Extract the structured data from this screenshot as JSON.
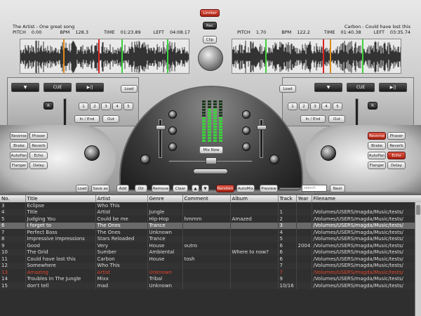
{
  "deck_left": {
    "track": "The Artist - One great song",
    "pitch_label": "PITCH",
    "pitch": "0.00",
    "bpm_label": "BPM",
    "bpm": "128.3",
    "time_label": "TIME",
    "time": "01:23.89",
    "left_label": "LEFT",
    "left": "04:08.17",
    "buttons": {
      "play_prev": "▼",
      "cue": "CUE",
      "play_pause": "▶||",
      "load": "Load",
      "r": "R",
      "in_end": "In / End",
      "out": "Out",
      "nums": [
        "1",
        "2",
        "3",
        "4",
        "5"
      ]
    },
    "effects": [
      {
        "label": "Reverse",
        "active": false
      },
      {
        "label": "Phaser",
        "active": false
      },
      {
        "label": "Brake",
        "active": false
      },
      {
        "label": "Reverb",
        "active": false
      },
      {
        "label": "AutoPan",
        "active": false
      },
      {
        "label": "Echo",
        "active": false
      },
      {
        "label": "Flanger",
        "active": false
      },
      {
        "label": "Delay",
        "active": false
      }
    ],
    "nudge": ">"
  },
  "deck_right": {
    "track": "Carbon - Could have lost this",
    "pitch_label": "PITCH",
    "pitch": "1.70",
    "bpm_label": "BPM",
    "bpm": "122.2",
    "time_label": "TIME",
    "time": "01:40.38",
    "left_label": "LEFT",
    "left": "03:35.74",
    "buttons": {
      "play_prev": "▼",
      "cue": "CUE",
      "play_pause": "▶||",
      "load": "Load",
      "r": "R",
      "in_end": "In / End",
      "out": "Out",
      "nums": [
        "1",
        "2",
        "3",
        "4",
        "5"
      ]
    },
    "effects": [
      {
        "label": "Reverse",
        "active": true
      },
      {
        "label": "Phaser",
        "active": false
      },
      {
        "label": "Brake",
        "active": false
      },
      {
        "label": "Reverb",
        "active": false
      },
      {
        "label": "AutoPan",
        "active": false
      },
      {
        "label": "Echo",
        "active": true
      },
      {
        "label": "Flanger",
        "active": false
      },
      {
        "label": "Delay",
        "active": false
      }
    ],
    "nudge": "<"
  },
  "center": {
    "limiter": "Limiter",
    "rec": "Rec",
    "clip": "Clip",
    "mix_now": "Mix Now"
  },
  "library_bar": {
    "buttons": [
      "Load",
      "Save as",
      "Add",
      "Dir",
      "Remove",
      "Clear"
    ],
    "random": "Random",
    "automix": "AutoMix",
    "preview": "Preview",
    "search_placeholder": "search songs",
    "next": "Next"
  },
  "table": {
    "columns": [
      "No.",
      "Title",
      "Artist",
      "Genre",
      "Comment",
      "Album",
      "Track",
      "Year",
      "Filename"
    ],
    "rows": [
      {
        "no": "3",
        "title": "Eclipse",
        "artist": "Who This",
        "genre": "",
        "comment": "",
        "album": "",
        "track": "",
        "year": "",
        "file": "",
        "style": ""
      },
      {
        "no": "4",
        "title": "Title",
        "artist": "Artist",
        "genre": "Jungle",
        "comment": "",
        "album": "",
        "track": "1",
        "year": "",
        "file": "/Volumes/USERS/magda/Music/tests/",
        "style": "alt"
      },
      {
        "no": "5",
        "title": "Judging You",
        "artist": "Could be me",
        "genre": "Hip-Hop",
        "comment": "hmmm",
        "album": "Amazed",
        "track": "2",
        "year": "",
        "file": "/Volumes/USERS/magda/Music/tests/",
        "style": ""
      },
      {
        "no": "6",
        "title": "I forget to",
        "artist": "The Ones",
        "genre": "Trance",
        "comment": "",
        "album": "",
        "track": "3",
        "year": "",
        "file": "/Volumes/USERS/magda/Music/tests/",
        "style": "sel"
      },
      {
        "no": "7",
        "title": "Perfect Bass",
        "artist": "The Ones",
        "genre": "Unknown",
        "comment": "",
        "album": "",
        "track": "4",
        "year": "",
        "file": "/Volumes/USERS/magda/Music/tests/",
        "style": ""
      },
      {
        "no": "8",
        "title": "Impressive Impressions",
        "artist": "Stars Reloaded",
        "genre": "Trance",
        "comment": "",
        "album": "",
        "track": "5",
        "year": "",
        "file": "/Volumes/USERS/magda/Music/tests/",
        "style": "alt"
      },
      {
        "no": "9",
        "title": "Good",
        "artist": "Very",
        "genre": "House",
        "comment": "outro",
        "album": "",
        "track": "6",
        "year": "2004",
        "file": "/Volumes/USERS/magda/Music/tests/",
        "style": ""
      },
      {
        "no": "10",
        "title": "The Grid",
        "artist": "Sumber",
        "genre": "Ambiental",
        "comment": "",
        "album": "Where to now?",
        "track": "6",
        "year": "",
        "file": "/Volumes/USERS/magda/Music/tests/",
        "style": "alt"
      },
      {
        "no": "11",
        "title": "Could have lost this",
        "artist": "Carbon",
        "genre": "House",
        "comment": "tosh",
        "album": "",
        "track": "6",
        "year": "",
        "file": "/Volumes/USERS/magda/Music/tests/",
        "style": ""
      },
      {
        "no": "12",
        "title": "Somewhere",
        "artist": "Who This",
        "genre": "",
        "comment": "",
        "album": "",
        "track": "7",
        "year": "",
        "file": "/Volumes/USERS/magda/Music/tests/",
        "style": "alt"
      },
      {
        "no": "13",
        "title": "Amazing",
        "artist": "Artist",
        "genre": "Unknown",
        "comment": "",
        "album": "",
        "track": "7",
        "year": "",
        "file": "/Volumes/USERS/magda/Music/tests/",
        "style": "red"
      },
      {
        "no": "14",
        "title": "Troubles In The Jungle",
        "artist": "Mixx",
        "genre": "Tribal",
        "comment": "",
        "album": "",
        "track": "9",
        "year": "",
        "file": "/Volumes/USERS/magda/Music/tests/",
        "style": ""
      },
      {
        "no": "15",
        "title": "don't tell",
        "artist": "mad",
        "genre": "Unknown",
        "comment": "",
        "album": "",
        "track": "10/16",
        "year": "",
        "file": "/Volumes/USERS/magda/Music/tests/",
        "style": "alt"
      }
    ]
  },
  "colors": {
    "accent_red": "#c8321f",
    "vu_green": "#3cd23c",
    "marker_orange": "#e08a1c"
  },
  "icons": [
    "play-icon",
    "pause-icon",
    "knob-icon",
    "speaker-icon"
  ]
}
